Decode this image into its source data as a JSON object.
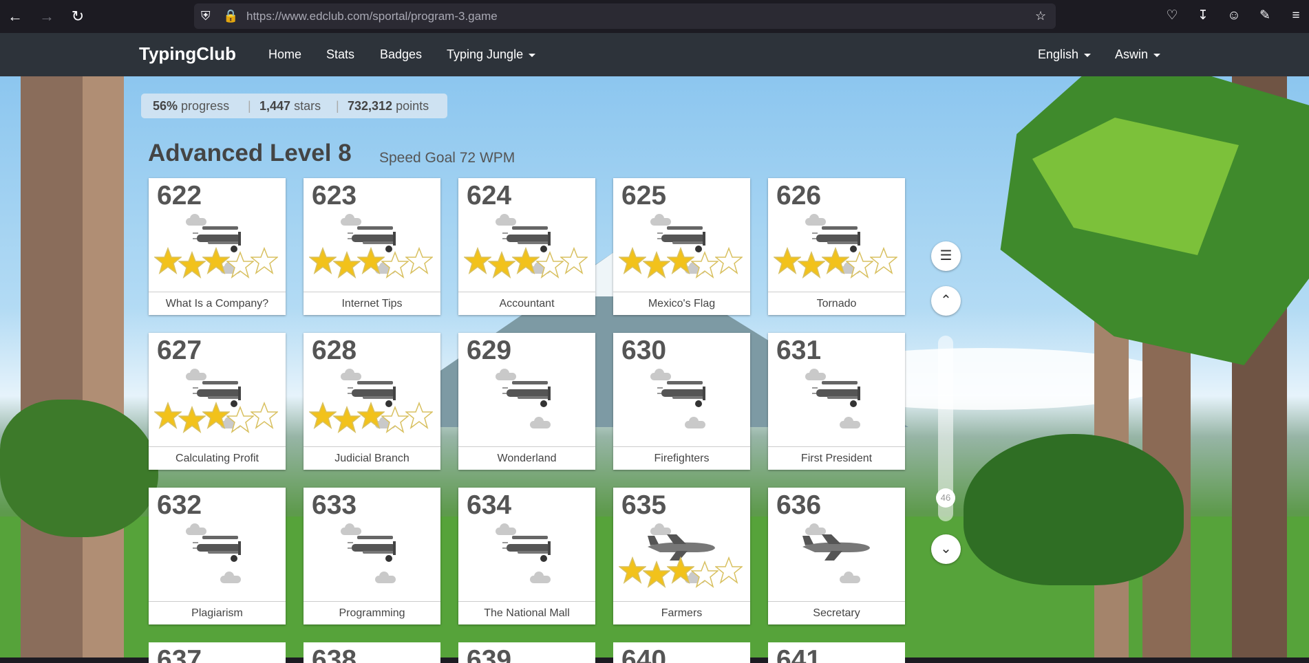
{
  "browser": {
    "url": "https://www.edclub.com/sportal/program-3.game"
  },
  "nav": {
    "brand": "TypingClub",
    "links": [
      "Home",
      "Stats",
      "Badges",
      "Typing Jungle"
    ],
    "language": "English",
    "user": "Aswin"
  },
  "stats": {
    "progress": "56%",
    "progress_label": "progress",
    "stars": "1,447",
    "stars_label": "stars",
    "points": "732,312",
    "points_label": "points"
  },
  "level": {
    "title": "Advanced Level 8",
    "goal": "Speed Goal 72 WPM"
  },
  "lessons": [
    {
      "num": "622",
      "name": "What Is a Company?",
      "stars": 3,
      "vehicle": "biplane"
    },
    {
      "num": "623",
      "name": "Internet Tips",
      "stars": 3,
      "vehicle": "biplane"
    },
    {
      "num": "624",
      "name": "Accountant",
      "stars": 3,
      "vehicle": "biplane"
    },
    {
      "num": "625",
      "name": "Mexico's Flag",
      "stars": 3,
      "vehicle": "biplane"
    },
    {
      "num": "626",
      "name": "Tornado",
      "stars": 3,
      "vehicle": "biplane"
    },
    {
      "num": "627",
      "name": "Calculating Profit",
      "stars": 3,
      "vehicle": "biplane"
    },
    {
      "num": "628",
      "name": "Judicial Branch",
      "stars": 3,
      "vehicle": "biplane"
    },
    {
      "num": "629",
      "name": "Wonderland",
      "stars": 0,
      "vehicle": "biplane"
    },
    {
      "num": "630",
      "name": "Firefighters",
      "stars": 0,
      "vehicle": "biplane"
    },
    {
      "num": "631",
      "name": "First President",
      "stars": 0,
      "vehicle": "biplane"
    },
    {
      "num": "632",
      "name": "Plagiarism",
      "stars": 0,
      "vehicle": "biplane"
    },
    {
      "num": "633",
      "name": "Programming",
      "stars": 0,
      "vehicle": "biplane"
    },
    {
      "num": "634",
      "name": "The National Mall",
      "stars": 0,
      "vehicle": "biplane"
    },
    {
      "num": "635",
      "name": "Farmers",
      "stars": 3,
      "vehicle": "jet"
    },
    {
      "num": "636",
      "name": "Secretary",
      "stars": 0,
      "vehicle": "jet"
    }
  ],
  "partial_lessons": [
    "637",
    "638",
    "639",
    "640",
    "641"
  ],
  "scroll": {
    "position_label": "46"
  },
  "colors": {
    "star_filled": "#f2c21b",
    "star_empty": "#ffffff",
    "navbar": "#2d333a"
  }
}
